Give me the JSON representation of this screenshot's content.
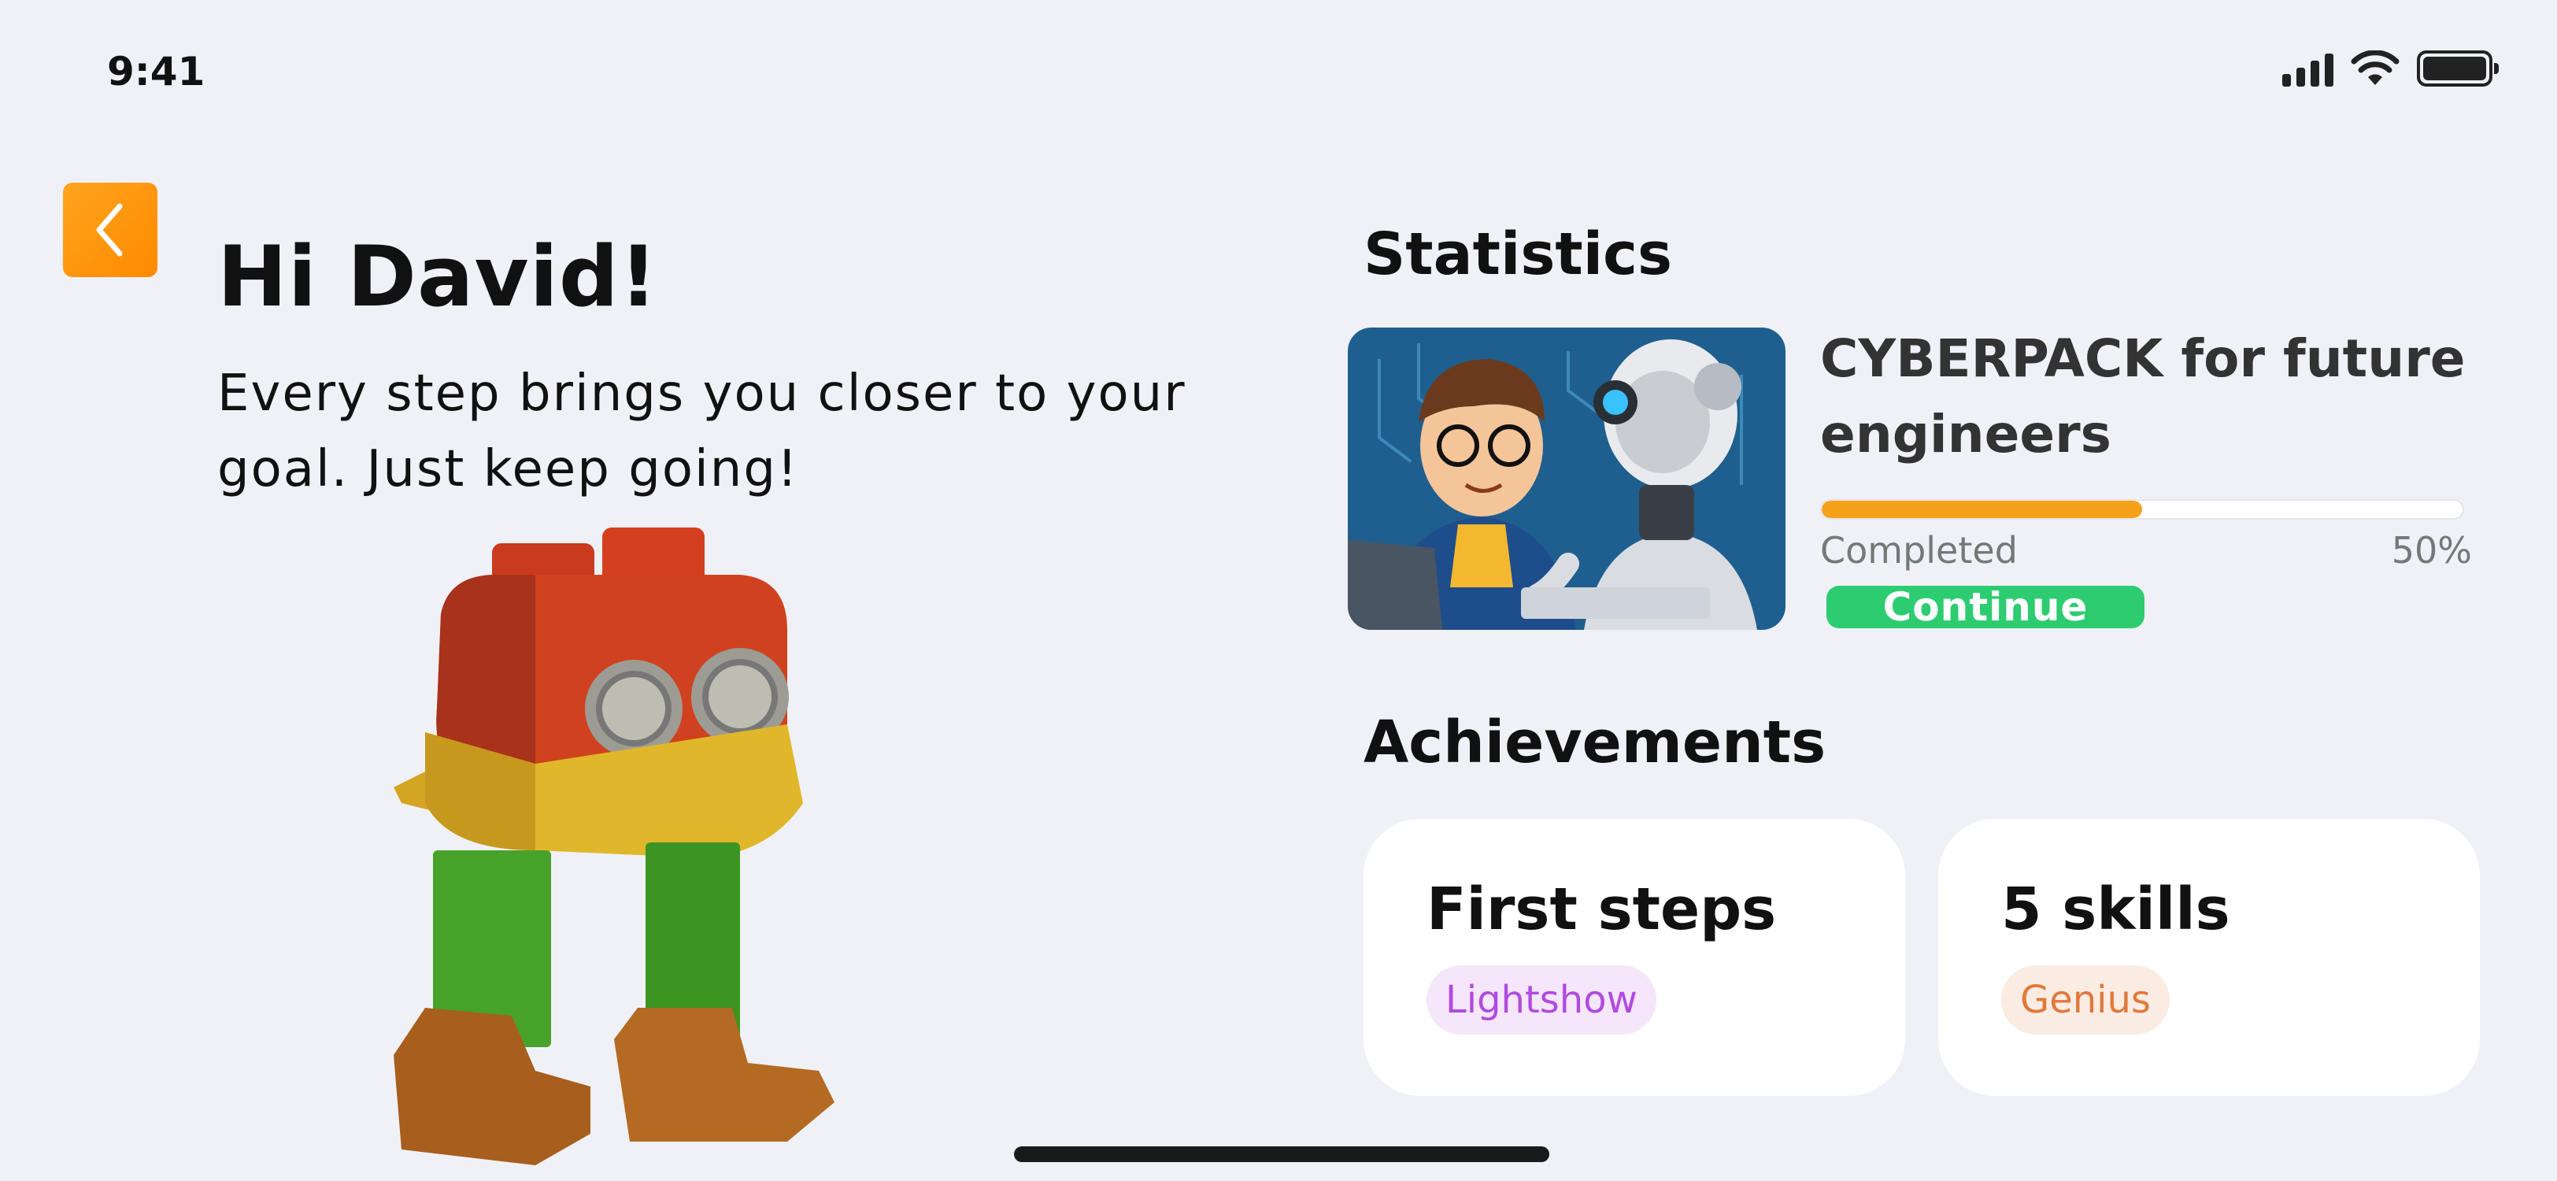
{
  "status_bar": {
    "time": "9:41"
  },
  "header": {
    "back_icon": "chevron-left-icon",
    "greeting": "Hi David!",
    "subtitle": "Every step brings you closer to your goal. Just keep going!"
  },
  "statistics": {
    "title": "Statistics",
    "course": {
      "title": "CYBERPACK for future engineers",
      "progress": 0.5,
      "completed_label": "Completed",
      "percent_label": "50%",
      "continue_label": "Continue"
    }
  },
  "achievements": {
    "title": "Achievements",
    "items": [
      {
        "title": "First steps",
        "tag": "Lightshow",
        "tag_color": "#b04be0",
        "tag_bg": "#f5e6fb"
      },
      {
        "title": "5 skills",
        "tag": "Genius",
        "tag_color": "#e0793a",
        "tag_bg": "#fbece3"
      }
    ]
  },
  "colors": {
    "accent_orange": "#ff9a10",
    "progress_fill": "#f5a11a",
    "continue_green": "#2ecc71",
    "background": "#f0f1f7"
  }
}
